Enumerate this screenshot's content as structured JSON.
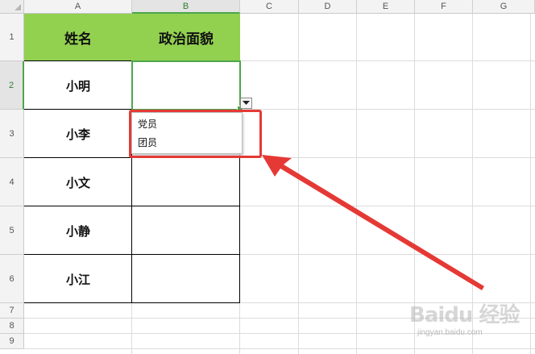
{
  "columns": [
    "A",
    "B",
    "C",
    "D",
    "E",
    "F",
    "G"
  ],
  "rows": [
    "1",
    "2",
    "3",
    "4",
    "5",
    "6",
    "7",
    "8",
    "9"
  ],
  "table": {
    "header_name": "姓名",
    "header_political": "政治面貌",
    "names": [
      "小明",
      "小李",
      "小文",
      "小静",
      "小江"
    ]
  },
  "dropdown": {
    "options": [
      "党员",
      "团员"
    ]
  },
  "colors": {
    "header_fill": "#92d050",
    "selection": "#4ca64c",
    "annotation": "#e53935"
  },
  "watermark": {
    "brand": "Baidu 经验",
    "site": "jingyan.baidu.com"
  }
}
